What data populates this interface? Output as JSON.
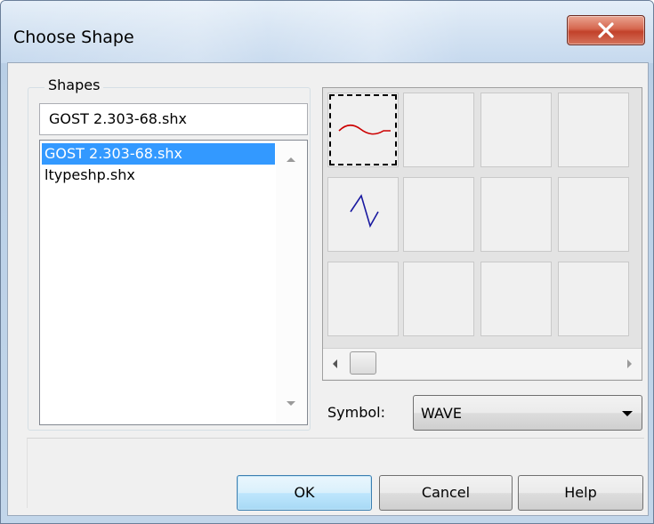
{
  "window": {
    "title": "Choose Shape"
  },
  "shapes": {
    "group_label": "Shapes",
    "selected_file": "GOST 2.303-68.shx",
    "files": [
      "GOST 2.303-68.shx",
      "ltypeshp.shx"
    ],
    "selected_index": 0
  },
  "preview_grid": {
    "cells": [
      {
        "icon": "wave-shape-icon",
        "selected": true
      },
      {
        "icon": "",
        "selected": false
      },
      {
        "icon": "",
        "selected": false
      },
      {
        "icon": "",
        "selected": false
      },
      {
        "icon": "zigzag-shape-icon",
        "selected": false
      },
      {
        "icon": "",
        "selected": false
      },
      {
        "icon": "",
        "selected": false
      },
      {
        "icon": "",
        "selected": false
      },
      {
        "icon": "",
        "selected": false
      },
      {
        "icon": "",
        "selected": false
      },
      {
        "icon": "",
        "selected": false
      },
      {
        "icon": "",
        "selected": false
      }
    ],
    "colors": {
      "wave": "#cc0000",
      "zigzag": "#1a1aa0"
    }
  },
  "symbol": {
    "label": "Symbol:",
    "value": "WAVE"
  },
  "buttons": {
    "ok": "OK",
    "cancel": "Cancel",
    "help": "Help"
  }
}
